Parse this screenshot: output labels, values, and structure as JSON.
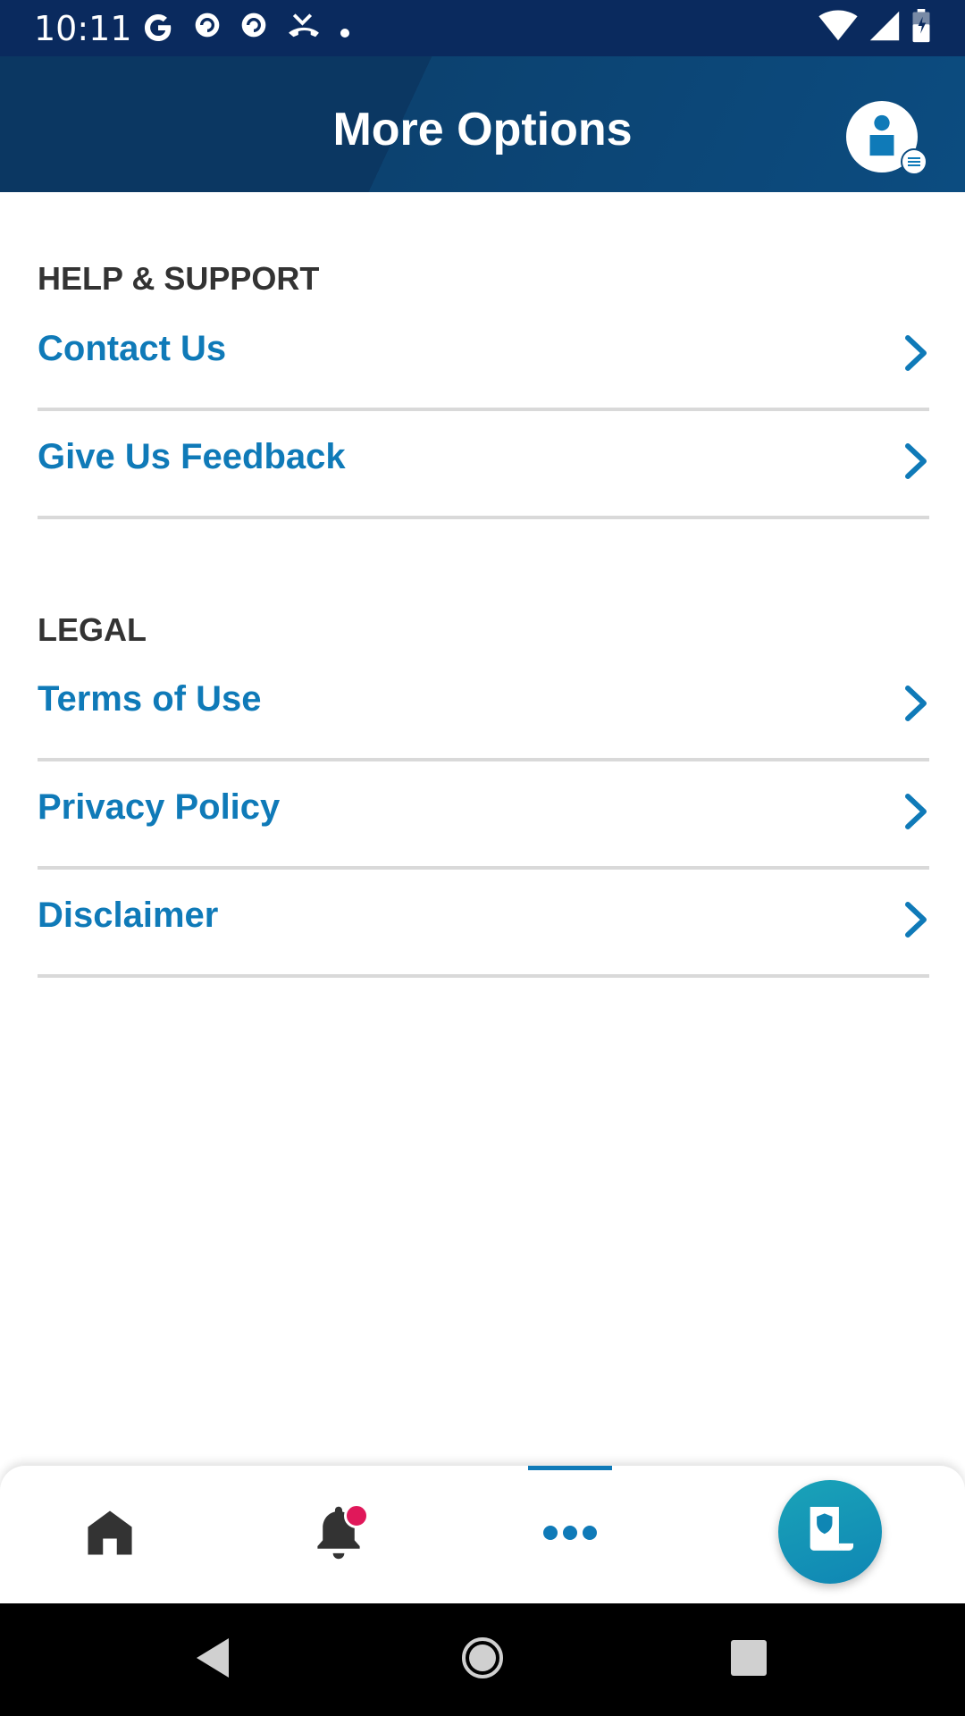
{
  "status_bar": {
    "time": "10:11",
    "left_icons": [
      "google-icon",
      "pocket-casts-icon",
      "pocket-casts-icon",
      "missed-call-icon",
      "dot-icon"
    ],
    "right_icons": [
      "wifi-icon",
      "signal-icon",
      "battery-icon"
    ]
  },
  "header": {
    "title": "More Options",
    "profile_icon": "user-icon"
  },
  "sections": [
    {
      "title": "HELP & SUPPORT",
      "items": [
        {
          "label": "Contact Us"
        },
        {
          "label": "Give Us Feedback"
        }
      ]
    },
    {
      "title": "LEGAL",
      "items": [
        {
          "label": "Terms of Use"
        },
        {
          "label": "Privacy Policy"
        },
        {
          "label": "Disclaimer"
        }
      ]
    }
  ],
  "bottom_nav": {
    "items": [
      "home-icon",
      "notifications-icon",
      "more-icon",
      "policy-card-icon"
    ],
    "active": "more-icon",
    "notification_dot": true
  },
  "colors": {
    "header_bg": "#0b3762",
    "accent": "#0f7ab8",
    "section_title": "#333333",
    "divider": "#d9d9d9",
    "notification_dot": "#e0185a",
    "fab": "#1aa3b8"
  }
}
